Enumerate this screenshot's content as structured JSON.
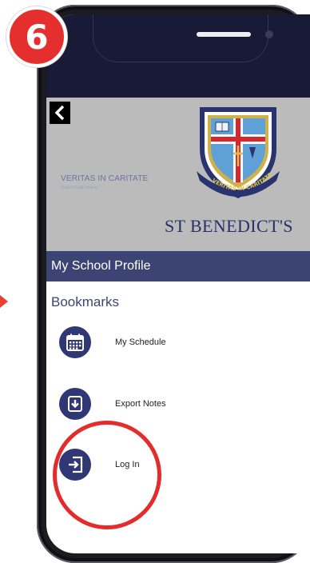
{
  "step": {
    "number": "6",
    "color": "#e52f2f"
  },
  "app": {
    "back_icon": "chevron-left-icon",
    "banner": {
      "motto": "VERITAS IN CARITATE",
      "motto_translation": "Truth through Charity",
      "school_name": "ST BENEDICT'S",
      "crest_ribbon": "VERITAS IN CARITATE"
    },
    "profile_header": "My School Profile",
    "section_title": "Bookmarks",
    "menu": [
      {
        "label": "My Schedule",
        "icon": "calendar-icon"
      },
      {
        "label": "Export Notes",
        "icon": "download-icon"
      },
      {
        "label": "Log In",
        "icon": "login-icon"
      }
    ]
  },
  "colors": {
    "nav_dark": "#191a35",
    "profile_bar": "#3c4474",
    "menu_icon_bg": "#2f3774",
    "highlight": "#e52c2c",
    "banner_bg": "#bbbbbb"
  }
}
